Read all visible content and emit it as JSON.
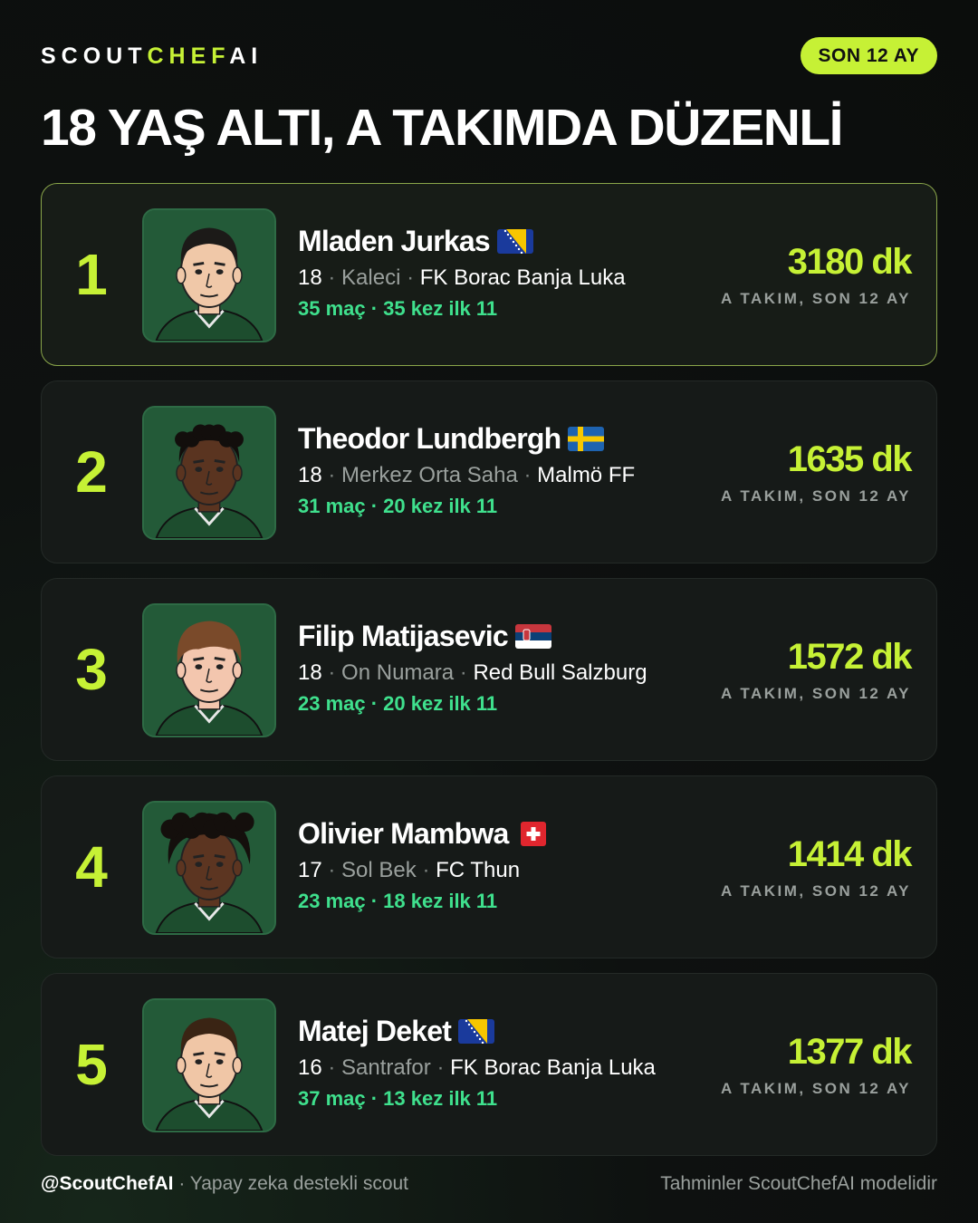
{
  "brand": {
    "part1": "SCOUT",
    "part2": "CHEF",
    "part3": "AI"
  },
  "period_badge": "SON 12 AY",
  "title": "18 YAŞ ALTI, A TAKIMDA DÜZENLİ",
  "players": [
    {
      "rank": "1",
      "name": "Mladen Jurkas",
      "flag": "bosnia-flag-icon",
      "age": "18",
      "position": "Kaleci",
      "club": "FK Borac Banja Luka",
      "stats": "35 maç · 35 kez ilk 11",
      "minutes": "3180 dk",
      "minutes_label": "A TAKIM, SON 12 AY",
      "skin": "#f0c8a8",
      "hair": "#1c1a18",
      "hair_style": "short"
    },
    {
      "rank": "2",
      "name": "Theodor Lundbergh",
      "flag": "sweden-flag-icon",
      "age": "18",
      "position": "Merkez Orta Saha",
      "club": "Malmö FF",
      "stats": "31 maç · 20 kez ilk 11",
      "minutes": "1635 dk",
      "minutes_label": "A TAKIM, SON 12 AY",
      "skin": "#5a3420",
      "hair": "#120e0c",
      "hair_style": "curly"
    },
    {
      "rank": "3",
      "name": "Filip Matijasevic",
      "flag": "serbia-flag-icon",
      "age": "18",
      "position": "On Numara",
      "club": "Red Bull Salzburg",
      "stats": "23 maç · 20 kez ilk 11",
      "minutes": "1572 dk",
      "minutes_label": "A TAKIM, SON 12 AY",
      "skin": "#f3c6ae",
      "hair": "#7a4a2a",
      "hair_style": "fringe"
    },
    {
      "rank": "4",
      "name": "Olivier Mambwa",
      "flag": "switzerland-flag-icon",
      "age": "17",
      "position": "Sol Bek",
      "club": "FC Thun",
      "stats": "23 maç · 18 kez ilk 11",
      "minutes": "1414 dk",
      "minutes_label": "A TAKIM, SON 12 AY",
      "skin": "#5c3521",
      "hair": "#140f0c",
      "hair_style": "afro"
    },
    {
      "rank": "5",
      "name": "Matej Deket",
      "flag": "bosnia-flag-icon",
      "age": "16",
      "position": "Santrafor",
      "club": "FK Borac Banja Luka",
      "stats": "37 maç · 13 kez ilk 11",
      "minutes": "1377 dk",
      "minutes_label": "A TAKIM, SON 12 AY",
      "skin": "#f0c6a6",
      "hair": "#3a2414",
      "hair_style": "short"
    }
  ],
  "footer": {
    "handle": "@ScoutChefAI",
    "tagline": "· Yapay zeka destekli scout",
    "note": "Tahminler ScoutChefAI modelidir"
  },
  "colors": {
    "accent": "#c6f135",
    "stats": "#3fe08d",
    "avatar_bg": "#235a38"
  }
}
